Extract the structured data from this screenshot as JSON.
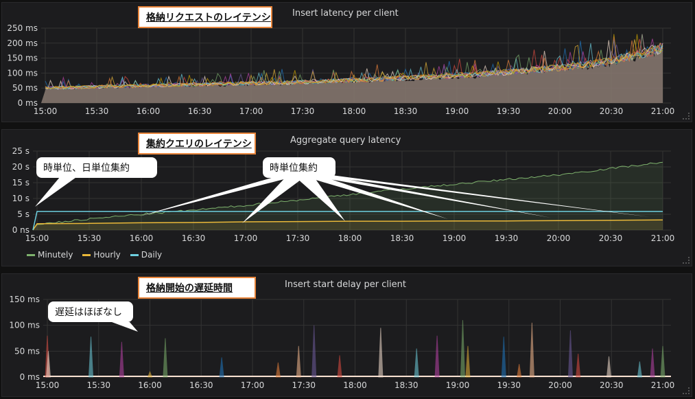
{
  "colors": {
    "minutely": "#7eb26d",
    "hourly": "#eab839",
    "daily": "#6ed0e0",
    "callout_border": "#e8843a"
  },
  "panels": [
    {
      "title": "Insert latency per client",
      "callout": "格納リクエストのレイテンシ"
    },
    {
      "title": "Aggregate query latency",
      "callout": "集約クエリのレイテンシ",
      "note_left": "時単位、日単位集約",
      "note_right": "時単位集約"
    },
    {
      "title": "Insert start delay per client",
      "callout": "格納開始の遅延時間",
      "note": "遅延はほぼなし"
    }
  ],
  "chart_data": [
    {
      "type": "line",
      "title": "Insert latency per client",
      "x_ticks": [
        "15:00",
        "15:30",
        "16:00",
        "16:30",
        "17:00",
        "17:30",
        "18:00",
        "18:30",
        "19:00",
        "19:30",
        "20:00",
        "20:30",
        "21:00"
      ],
      "y_ticks": [
        "0 ms",
        "50 ms",
        "100 ms",
        "150 ms",
        "200 ms",
        "250 ms"
      ],
      "ylim": [
        0,
        250
      ],
      "series": [
        {
          "values": [
            50,
            54,
            58,
            62,
            66,
            70,
            76,
            84,
            92,
            104,
            118,
            140,
            185
          ]
        }
      ],
      "grid": true
    },
    {
      "type": "line",
      "title": "Aggregate query latency",
      "x_ticks": [
        "15:00",
        "15:30",
        "16:00",
        "16:30",
        "17:00",
        "17:30",
        "18:00",
        "18:30",
        "19:00",
        "19:30",
        "20:00",
        "20:30",
        "21:00"
      ],
      "y_ticks": [
        "0 ns",
        "5 s",
        "10 s",
        "15 s",
        "20 s",
        "25 s"
      ],
      "ylim": [
        0,
        25
      ],
      "legend": "bottom-left",
      "series": [
        {
          "name": "Minutely",
          "values": [
            1.8,
            3.5,
            5,
            6.3,
            7.8,
            9.5,
            11.3,
            13,
            14.5,
            16,
            17.5,
            19.5,
            21.5
          ]
        },
        {
          "name": "Hourly",
          "values": [
            2,
            2.1,
            2.3,
            2.4,
            2.6,
            2.7,
            2.8,
            2.8,
            2.9,
            2.9,
            3,
            3.1,
            3.2
          ]
        },
        {
          "name": "Daily",
          "values": [
            5.9,
            5.9,
            5.9,
            5.9,
            5.9,
            5.9,
            5.9,
            5.9,
            5.9,
            5.9,
            5.9,
            5.9,
            5.9
          ]
        }
      ],
      "grid": true
    },
    {
      "type": "line",
      "title": "Insert start delay per client",
      "x_ticks": [
        "15:00",
        "15:30",
        "16:00",
        "16:30",
        "17:00",
        "17:30",
        "18:00",
        "18:30",
        "19:00",
        "19:30",
        "20:00",
        "20:30",
        "21:00"
      ],
      "y_ticks": [
        "0 ms",
        "50 ms",
        "100 ms",
        "150 ms"
      ],
      "ylim": [
        0,
        150
      ],
      "spikes": [
        {
          "t": 0.0,
          "v": 80
        },
        {
          "t": 0.02,
          "v": 50
        },
        {
          "t": 0.85,
          "v": 78
        },
        {
          "t": 1.45,
          "v": 68
        },
        {
          "t": 2.3,
          "v": 75
        },
        {
          "t": 2.0,
          "v": 10
        },
        {
          "t": 3.4,
          "v": 38
        },
        {
          "t": 4.5,
          "v": 28
        },
        {
          "t": 4.9,
          "v": 60
        },
        {
          "t": 5.2,
          "v": 100
        },
        {
          "t": 5.7,
          "v": 42
        },
        {
          "t": 6.5,
          "v": 95
        },
        {
          "t": 7.2,
          "v": 55
        },
        {
          "t": 7.6,
          "v": 80
        },
        {
          "t": 8.1,
          "v": 110
        },
        {
          "t": 8.2,
          "v": 60
        },
        {
          "t": 8.9,
          "v": 78
        },
        {
          "t": 9.2,
          "v": 25
        },
        {
          "t": 9.45,
          "v": 105
        },
        {
          "t": 10.2,
          "v": 90
        },
        {
          "t": 10.35,
          "v": 45
        },
        {
          "t": 10.95,
          "v": 40
        },
        {
          "t": 11.55,
          "v": 30
        },
        {
          "t": 11.8,
          "v": 55
        },
        {
          "t": 12.0,
          "v": 60
        }
      ],
      "grid": true
    }
  ]
}
